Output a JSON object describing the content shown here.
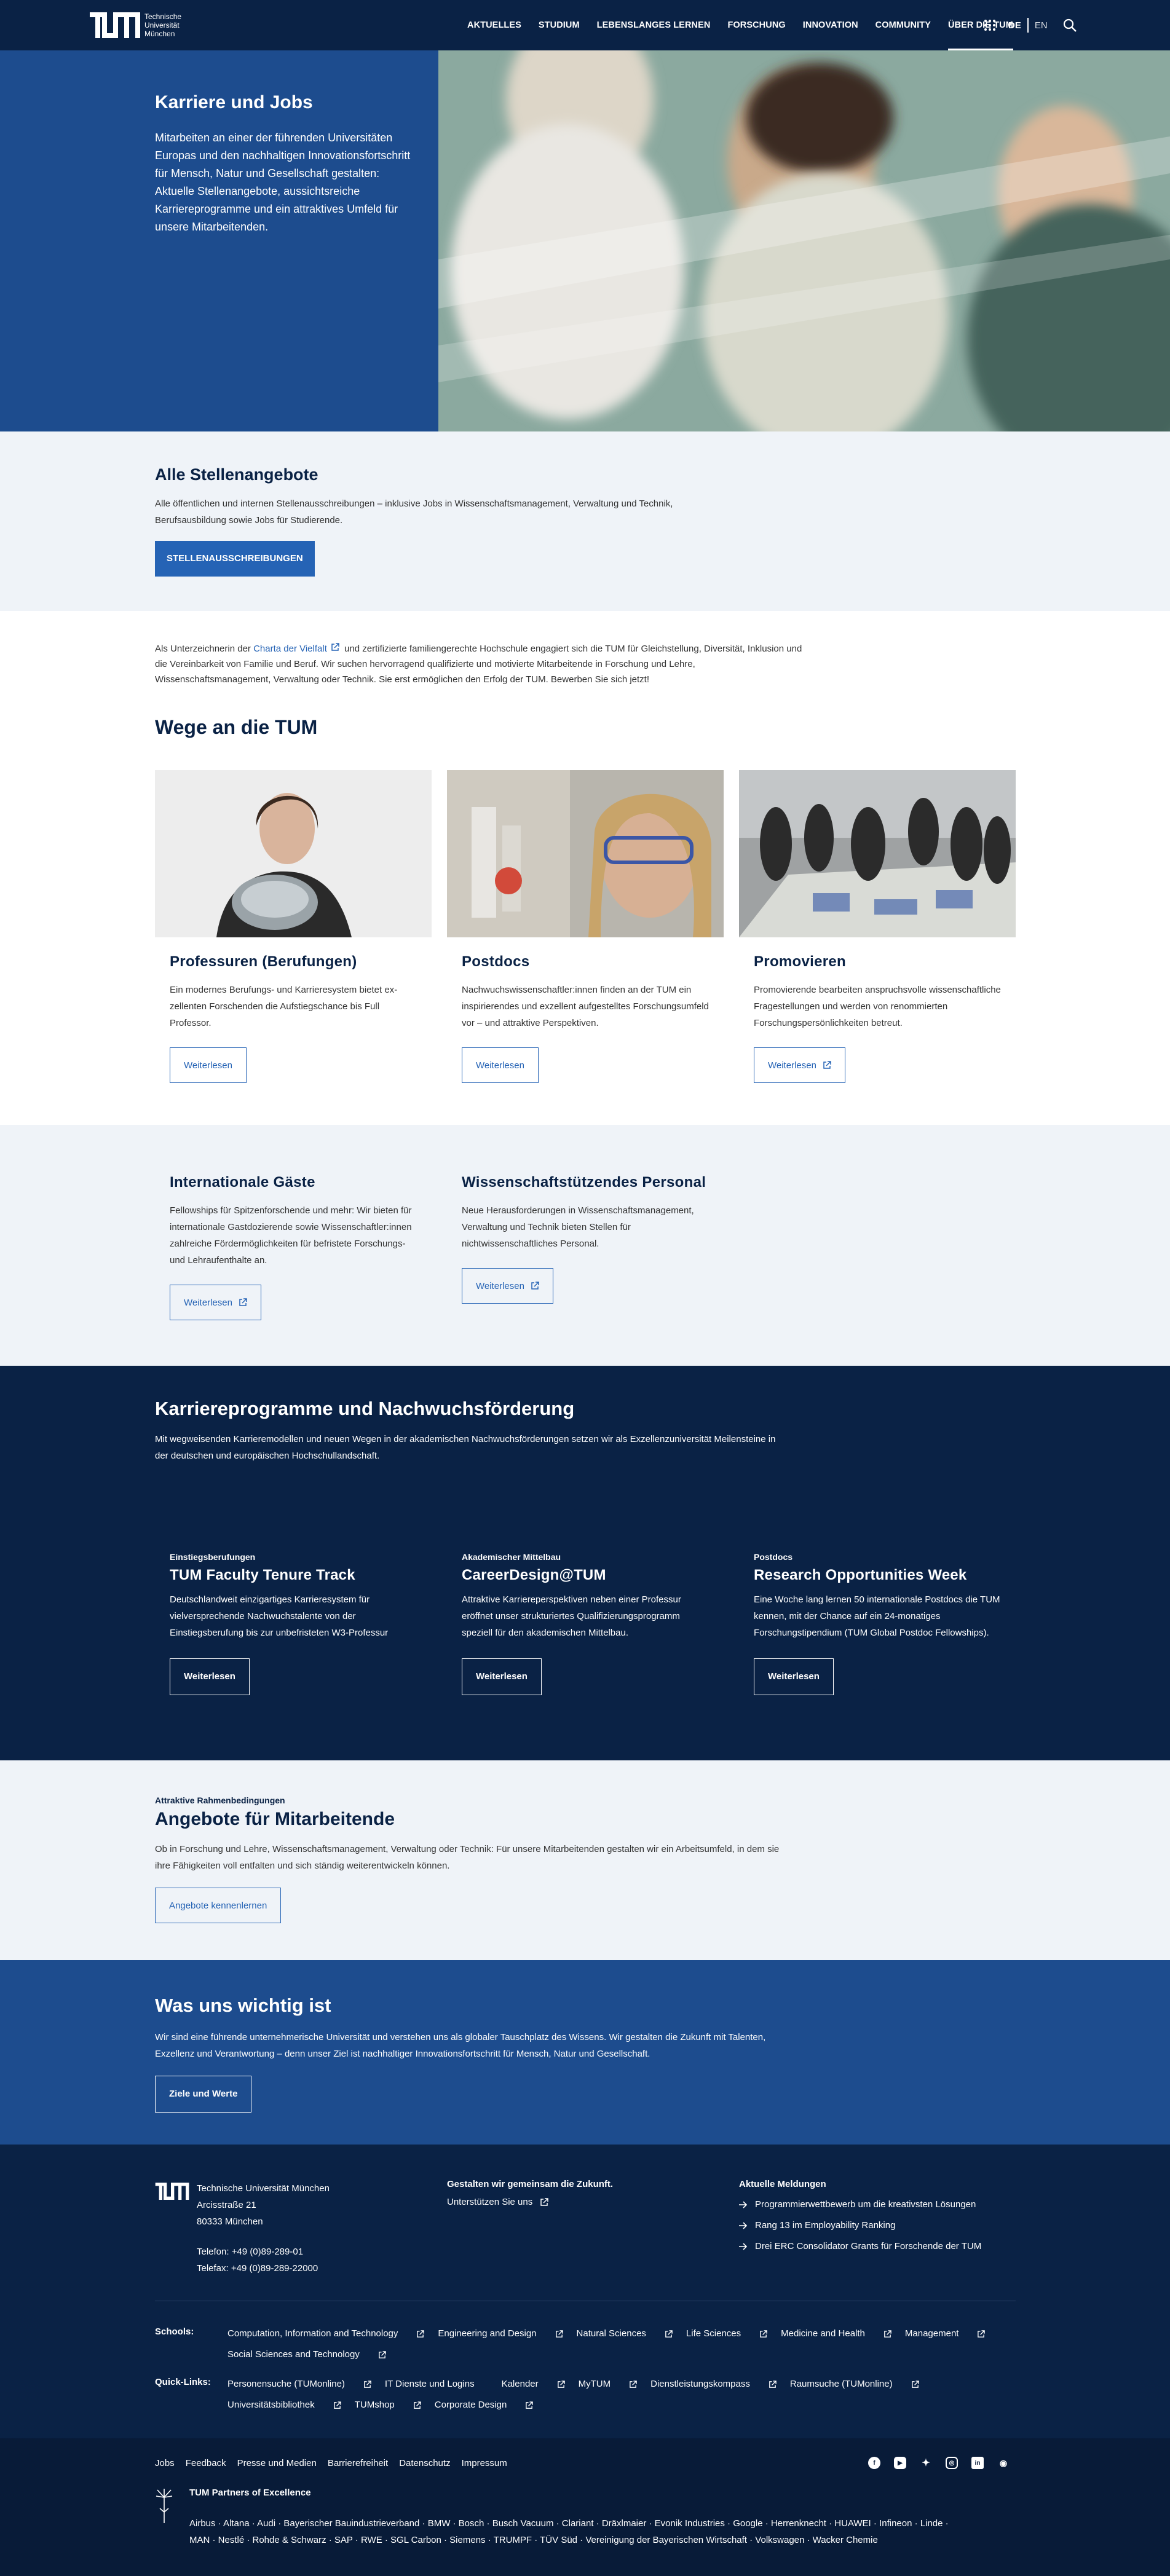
{
  "header": {
    "logo_text": [
      "Technische",
      "Universität",
      "München"
    ],
    "nav": [
      "AKTUELLES",
      "STUDIUM",
      "LEBENSLANGES LERNEN",
      "FORSCHUNG",
      "INNOVATION",
      "COMMUNITY",
      "ÜBER DIE TUM"
    ],
    "active_nav": "ÜBER DIE TUM",
    "lang_de": "DE",
    "lang_en": "EN",
    "icons": [
      "apps-grid-icon",
      "search-icon"
    ]
  },
  "hero": {
    "title": "Karriere und Jobs",
    "text": "Mitarbeiten an einer der führenden Universitäten Europas und den nachhaltigen Innovationsfortschritt für Mensch, Natur und Gesellschaft gestalten: Aktuelle Stellenangebote, aussichtsreiche Karriereprogramme und ein attraktives Umfeld für unsere Mitarbeitenden."
  },
  "stellen": {
    "title": "Alle Stellenangebote",
    "text": "Alle öffentlichen und internen Stellenausschreibungen – inklusive Jobs in Wissenschaftsmanagement, Verwaltung und Technik, Berufsausbildung sowie Jobs für Studierende.",
    "button": "STELLENAUSSCHREIBUNGEN"
  },
  "charta": {
    "pre": "Als Unterzeichnerin der ",
    "link": "Charta der Vielfalt",
    "post": " und zertifizierte familiengerechte Hochschule engagiert sich die TUM für Gleichstellung, Diversität, Inklusion und die Vereinbarkeit von Familie und Beruf. Wir suchen hervorragend qualifizierte und motivierte Mitarbeitende in Forschung und Lehre, Wissenschaftsmanagement, Verwaltung oder Technik. Sie erst ermöglichen den Erfolg der TUM. Bewerben Sie sich jetzt!"
  },
  "wege": {
    "title": "Wege an die TUM",
    "cards": [
      {
        "title": "Professuren (Berufungen)",
        "text": "Ein modernes Berufungs- und Karrieresystem bietet ex­zellenten Forschenden die Aufstiegschance bis Full Professor.",
        "button": "Weiterlesen"
      },
      {
        "title": "Postdocs",
        "text": "Nachwuchswissenschaftler:innen finden an der TUM ein inspirierendes und exzellent aufgestelltes Forschungsumfeld vor – und attraktive Perspektiven.",
        "button": "Weiterlesen"
      },
      {
        "title": "Promovieren",
        "text": "Promovierende bearbeiten anspruchsvolle wissenschaftliche Fragestellungen und werden von renommierten Forschungspersönlichkeiten betreut.",
        "button": "Weiterlesen"
      }
    ]
  },
  "gaeste": [
    {
      "title": "Internationale Gäste",
      "text": "Fellowships für Spitzenforschende und mehr: Wir bieten für internationale Gastdozierende sowie Wissenschaftler:innen zahlreiche Fördermöglichkeiten für befristete Forschungs- und Lehraufenthalte an.",
      "button": "Weiterlesen"
    },
    {
      "title": "Wissenschaftstützendes Personal",
      "text": "Neue Herausforderungen in Wissenschaftsmanagement, Verwaltung und Technik bieten Stellen für nichtwissenschaftliches Personal.",
      "button": "Weiterlesen"
    }
  ],
  "karriere": {
    "title": "Karriereprogramme und Nachwuchsförderung",
    "text": "Mit wegweisenden Karrieremodellen und neuen Wegen in der akademischen Nachwuchsförderungen setzen wir als Exzellenzuniversität Meilensteine in der deutschen und europäischen Hochschullandschaft.",
    "items": [
      {
        "kicker": "Einstiegsberufungen",
        "title": "TUM Faculty Tenure Track",
        "text": "Deutschlandweit einzigartiges Karrieresystem für vielversprechende Nachwuchstalente von der Einstiegsberufung bis zur unbefristeten W3-Professur",
        "button": "Weiterlesen"
      },
      {
        "kicker": "Akademischer Mittelbau",
        "title": "CareerDesign@TUM",
        "text": "Attraktive Karriereperspektiven neben einer Professur eröffnet unser strukturiertes Qualifizierungsprogramm speziell für den akademischen Mittelbau.",
        "button": "Weiterlesen"
      },
      {
        "kicker": "Postdocs",
        "title": "Research Opportunities Week",
        "text": "Eine Woche lang lernen 50 internationale Postdocs die TUM kennen, mit der Chance auf ein 24-monatiges Forschungstipendium (TUM Global Postdoc Fellowships).",
        "button": "Weiterlesen"
      }
    ]
  },
  "angebote": {
    "kicker": "Attraktive Rahmenbedingungen",
    "title": "Angebote für Mitarbeitende",
    "text": "Ob in Forschung und Lehre, Wissenschaftsmanagement, Verwaltung oder Technik: Für unsere Mitarbeitenden gestalten wir ein Arbeitsumfeld, in dem sie ihre Fähigkeiten voll entfalten und sich ständig weiterentwickeln können.",
    "button": "Angebote kennenlernen"
  },
  "wichtig": {
    "title": "Was uns wichtig ist",
    "text": "Wir sind eine führende unternehmerische Universität und verstehen uns als globaler Tauschplatz des Wissens. Wir gestalten die Zukunft mit Talenten, Exzellenz und Verantwortung – denn unser Ziel ist nachhaltiger Innovationsfortschritt für Mensch, Natur und Gesellschaft.",
    "button": "Ziele und Werte"
  },
  "footer": {
    "address": [
      "Technische Universität München",
      "Arcisstraße 21",
      "80333 München"
    ],
    "phone": "Telefon: +49 (0)89-289-01",
    "fax": "Telefax: +49 (0)89-289-22000",
    "support_title": "Gestalten wir gemeinsam die Zukunft.",
    "support_link": "Unterstützen Sie uns",
    "news_title": "Aktuelle Meldungen",
    "news": [
      "Programmierwettbewerb um die kreativsten Lösungen",
      "Rang 13 im Employability Ranking",
      "Drei ERC Consolidator Grants für Forschende der TUM"
    ],
    "schools_label": "Schools:",
    "schools": [
      "Computation, Information and Technology",
      "Engineering and Design",
      "Natural Sciences",
      "Life Sciences",
      "Medicine and Health",
      "Management",
      "Social Sciences and Technology"
    ],
    "quick_label": "Quick-Links:",
    "quick": [
      "Personensuche (TUMonline)",
      "IT Dienste und Logins",
      "Kalender",
      "MyTUM",
      "Dienstleistungskompass",
      "Raumsuche (TUMonline)",
      "Universitätsbibliothek",
      "TUMshop",
      "Corporate Design"
    ],
    "bottom_links": [
      "Jobs",
      "Feedback",
      "Presse und Medien",
      "Barrierefreiheit",
      "Datenschutz",
      "Impressum"
    ],
    "social_icons": [
      "facebook-icon",
      "youtube-icon",
      "twitter-icon",
      "instagram-icon",
      "linkedin-icon",
      "rss-icon"
    ],
    "partners_title": "TUM Partners of Excellence",
    "partners_line1": "Airbus · Altana · Audi · Bayerischer Bauindustrieverband · BMW · Bosch · Busch Vacuum · Clariant · Dräxlmaier · Evonik Industries · Google · Herrenknecht · HUAWEI · Infineon · Linde ·",
    "partners_line2": "MAN · Nestlé · Rohde & Schwarz · SAP · RWE · SGL Carbon · Siemens · TRUMPF · TÜV Süd · Vereinigung der Bayerischen Wirtschaft · Volkswagen · Wacker Chemie"
  }
}
